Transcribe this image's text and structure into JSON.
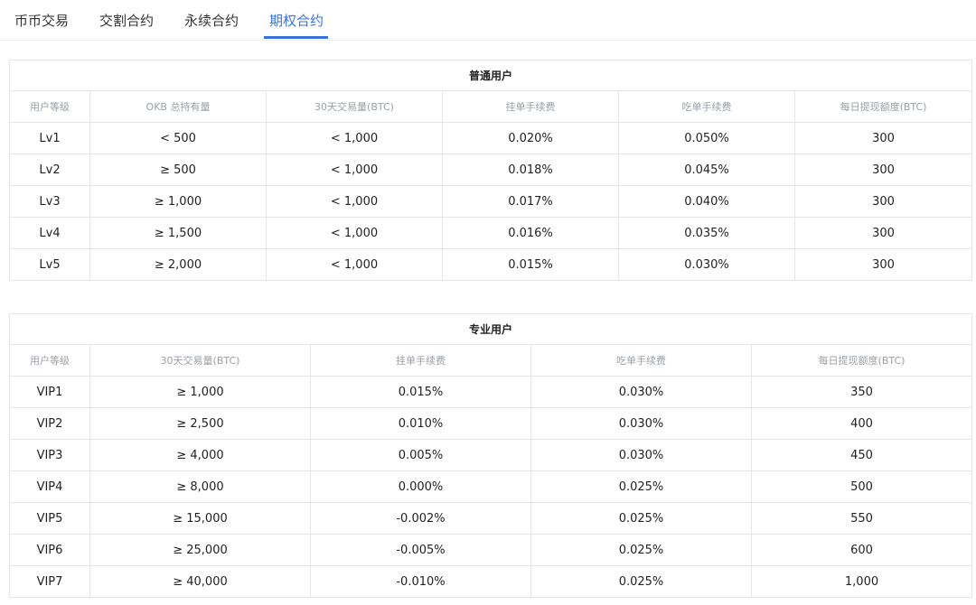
{
  "tabs": [
    {
      "label": "币币交易",
      "active": false
    },
    {
      "label": "交割合约",
      "active": false
    },
    {
      "label": "永续合约",
      "active": false
    },
    {
      "label": "期权合约",
      "active": true
    }
  ],
  "accent_color": "#3a73d8",
  "regular": {
    "title": "普通用户",
    "headers": [
      "用户等级",
      "OKB 总持有量",
      "30天交易量(BTC)",
      "挂单手续费",
      "吃单手续费",
      "每日提现额度(BTC)"
    ],
    "rows": [
      [
        "Lv1",
        "< 500",
        "< 1,000",
        "0.020%",
        "0.050%",
        "300"
      ],
      [
        "Lv2",
        "≥ 500",
        "< 1,000",
        "0.018%",
        "0.045%",
        "300"
      ],
      [
        "Lv3",
        "≥ 1,000",
        "< 1,000",
        "0.017%",
        "0.040%",
        "300"
      ],
      [
        "Lv4",
        "≥ 1,500",
        "< 1,000",
        "0.016%",
        "0.035%",
        "300"
      ],
      [
        "Lv5",
        "≥ 2,000",
        "< 1,000",
        "0.015%",
        "0.030%",
        "300"
      ]
    ]
  },
  "pro": {
    "title": "专业用户",
    "headers": [
      "用户等级",
      "30天交易量(BTC)",
      "挂单手续费",
      "吃单手续费",
      "每日提现额度(BTC)"
    ],
    "rows": [
      [
        "VIP1",
        "≥ 1,000",
        "0.015%",
        "0.030%",
        "350"
      ],
      [
        "VIP2",
        "≥ 2,500",
        "0.010%",
        "0.030%",
        "400"
      ],
      [
        "VIP3",
        "≥ 4,000",
        "0.005%",
        "0.030%",
        "450"
      ],
      [
        "VIP4",
        "≥ 8,000",
        "0.000%",
        "0.025%",
        "500"
      ],
      [
        "VIP5",
        "≥ 15,000",
        "-0.002%",
        "0.025%",
        "550"
      ],
      [
        "VIP6",
        "≥ 25,000",
        "-0.005%",
        "0.025%",
        "600"
      ],
      [
        "VIP7",
        "≥ 40,000",
        "-0.010%",
        "0.025%",
        "1,000"
      ]
    ]
  }
}
